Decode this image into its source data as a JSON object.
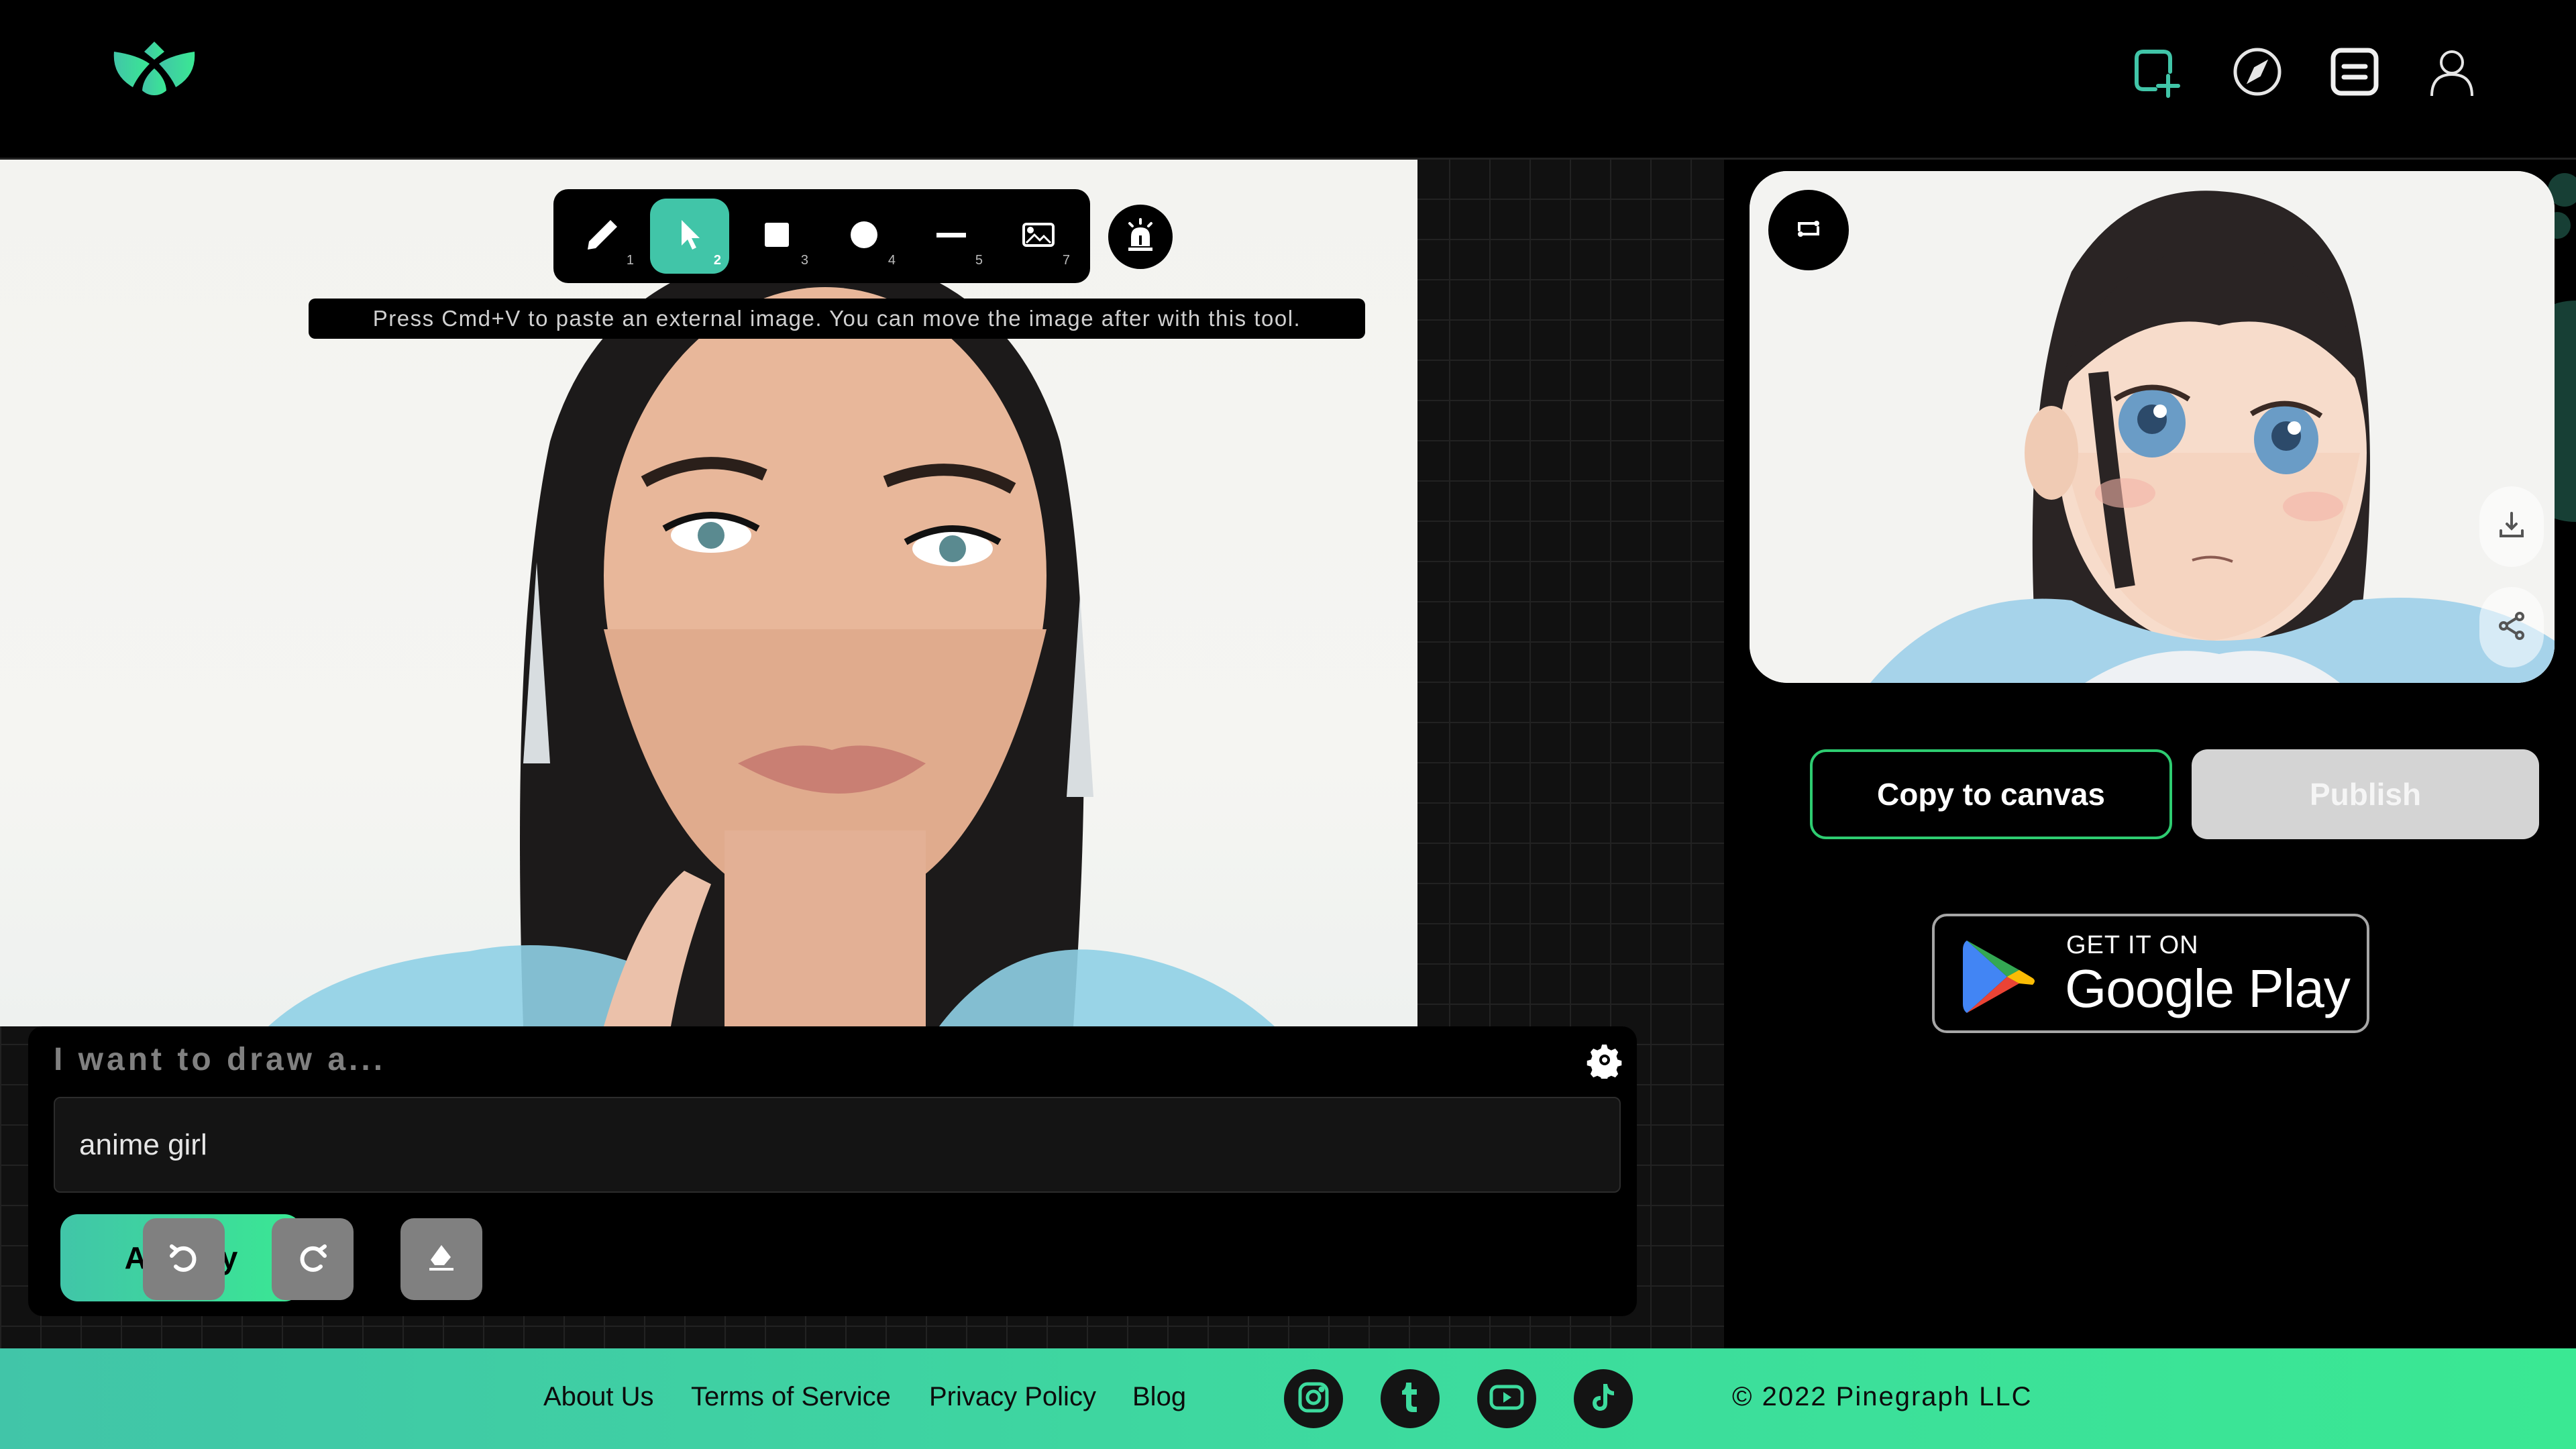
{
  "header": {
    "logo": "lotus-logo",
    "nav_icons": [
      {
        "name": "new-canvas-icon",
        "accent": "#41c5a8"
      },
      {
        "name": "explore-compass-icon"
      },
      {
        "name": "gallery-list-icon"
      },
      {
        "name": "profile-user-icon"
      }
    ]
  },
  "toolbar": {
    "tools": [
      {
        "name": "pencil-tool",
        "icon": "pencil-icon",
        "shortcut": "1",
        "active": false
      },
      {
        "name": "select-tool",
        "icon": "cursor-arrow-icon",
        "shortcut": "2",
        "active": true
      },
      {
        "name": "rectangle-tool",
        "icon": "square-icon",
        "shortcut": "3",
        "active": false
      },
      {
        "name": "circle-tool",
        "icon": "circle-icon",
        "shortcut": "4",
        "active": false
      },
      {
        "name": "line-tool",
        "icon": "line-icon",
        "shortcut": "5",
        "active": false
      },
      {
        "name": "image-tool",
        "icon": "image-icon",
        "shortcut": "7",
        "active": false
      }
    ],
    "alarm_icon": "alarm-siren-icon",
    "tooltip": "Press Cmd+V to paste an external image. You can move the image after with this tool."
  },
  "canvas": {
    "image_description": "Photo of a woman with dark hair and blue feather collar on white background"
  },
  "prompt": {
    "label": "I want to draw a...",
    "value": "anime girl",
    "amplify_label": "Amplify",
    "settings_icon": "gear-icon",
    "undo_icon": "undo-icon",
    "redo_icon": "redo-icon",
    "erase_icon": "eraser-icon"
  },
  "result": {
    "image_description": "Generated anime-style portrait of a girl with dark hair and blue eyes",
    "swap_icon": "swap-repeat-icon",
    "download_icon": "download-icon",
    "share_icon": "share-icon",
    "copy_label": "Copy to canvas",
    "publish_label": "Publish"
  },
  "store_badge": {
    "top": "GET IT ON",
    "main": "Google Play"
  },
  "footer": {
    "links": [
      "About Us",
      "Terms of Service",
      "Privacy Policy",
      "Blog"
    ],
    "socials": [
      "instagram-icon",
      "tumblr-icon",
      "youtube-icon",
      "tiktok-icon"
    ],
    "copyright": "© 2022 Pinegraph LLC"
  },
  "colors": {
    "accent_teal": "#41c5a8",
    "accent_green": "#3ae893",
    "copy_border": "#2ecc71",
    "publish_disabled": "#d4d4d4",
    "canvas_grid_bg": "#111111"
  }
}
